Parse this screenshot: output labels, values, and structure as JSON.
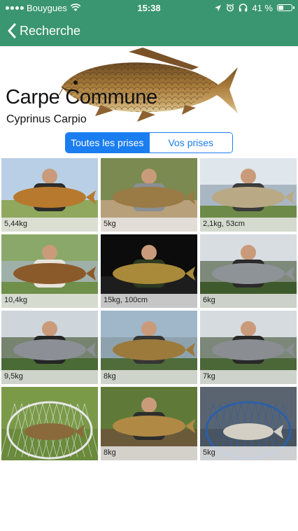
{
  "status_bar": {
    "carrier": "Bouygues",
    "time": "15:38",
    "battery": "41 %",
    "battery_level": 0.41
  },
  "nav": {
    "back_label": "Recherche"
  },
  "species": {
    "common_name": "Carpe Commune",
    "latin_name": "Cyprinus Carpio"
  },
  "tabs": [
    {
      "label": "Toutes les prises",
      "active": true
    },
    {
      "label": "Vos prises",
      "active": false
    }
  ],
  "catches": [
    {
      "caption": "5,44kg",
      "scene": "field"
    },
    {
      "caption": "5kg",
      "scene": "bank"
    },
    {
      "caption": "2,1kg, 53cm",
      "scene": "lake"
    },
    {
      "caption": "10,4kg",
      "scene": "lake2"
    },
    {
      "caption": "15kg, 100cm",
      "scene": "night"
    },
    {
      "caption": "6kg",
      "scene": "trees"
    },
    {
      "caption": "9,5kg",
      "scene": "trees2"
    },
    {
      "caption": "8kg",
      "scene": "lake3"
    },
    {
      "caption": "7kg",
      "scene": "trees3"
    },
    {
      "caption": "",
      "scene": "net"
    },
    {
      "caption": "8kg",
      "scene": "forest"
    },
    {
      "caption": "5kg",
      "scene": "bluenet"
    }
  ],
  "colors": {
    "header_green": "#3a9670",
    "segment_blue": "#1a7df0"
  }
}
